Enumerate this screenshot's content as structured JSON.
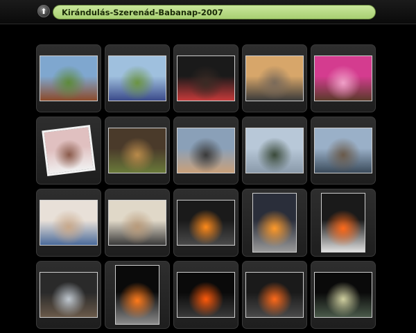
{
  "album": {
    "title": "Kirándulás-Szerenád-Babanap-2007",
    "up_icon": "up-arrow-icon"
  },
  "photos": [
    {
      "name": "photo-playground-slide",
      "shape": "land",
      "colors": [
        "#7fa7cf",
        "#5d8a3a",
        "#8c4a2a"
      ]
    },
    {
      "name": "photo-kids-on-lawn",
      "shape": "land",
      "colors": [
        "#9fc0de",
        "#6b9442",
        "#3a4a8a"
      ]
    },
    {
      "name": "photo-night-friends",
      "shape": "land",
      "colors": [
        "#1a1a1a",
        "#3a2a24",
        "#c63a3a"
      ]
    },
    {
      "name": "photo-girls-on-sofa",
      "shape": "land",
      "colors": [
        "#d7a66a",
        "#7a6a5a",
        "#3a3a3a"
      ]
    },
    {
      "name": "photo-heart-frame",
      "shape": "land",
      "colors": [
        "#d43c8f",
        "#f0a0c8",
        "#5a3a2a"
      ]
    },
    {
      "name": "photo-tilted-portrait",
      "shape": "rot",
      "colors": [
        "#e0c0c0",
        "#8a5a4a",
        "#f0f0f0"
      ]
    },
    {
      "name": "photo-blonde-girl",
      "shape": "land",
      "colors": [
        "#4a3a2a",
        "#b98a4a",
        "#6a7a3a"
      ]
    },
    {
      "name": "photo-two-girls-closeup",
      "shape": "land",
      "colors": [
        "#8aa0b8",
        "#3a3a3a",
        "#c9a07a"
      ]
    },
    {
      "name": "photo-group-street",
      "shape": "land",
      "colors": [
        "#b8c8d8",
        "#3a4a3a",
        "#8a9aaa"
      ]
    },
    {
      "name": "photo-church-group",
      "shape": "land",
      "colors": [
        "#9ab0c8",
        "#6a5a4a",
        "#3a4a5a"
      ]
    },
    {
      "name": "photo-indoor-table",
      "shape": "land",
      "colors": [
        "#e8e0d8",
        "#c8a88a",
        "#4a6a9a"
      ]
    },
    {
      "name": "photo-boys-sitting",
      "shape": "land",
      "colors": [
        "#e0d8c8",
        "#b89a7a",
        "#3a3a3a"
      ]
    },
    {
      "name": "photo-bonfire-1",
      "shape": "land",
      "colors": [
        "#1a1a1a",
        "#ff8a1a",
        "#4a4a4a"
      ]
    },
    {
      "name": "photo-bonfire-2",
      "shape": "port",
      "colors": [
        "#2a2e3a",
        "#ff9a2a",
        "#9a9a9a"
      ]
    },
    {
      "name": "photo-bonfire-3",
      "shape": "port",
      "colors": [
        "#1a1a1a",
        "#ff6a1a",
        "#e0e0e0"
      ]
    },
    {
      "name": "photo-night-group",
      "shape": "land",
      "colors": [
        "#2a2a2a",
        "#c0c8d0",
        "#6a5a4a"
      ]
    },
    {
      "name": "photo-dark-fire",
      "shape": "port",
      "colors": [
        "#0a0a0a",
        "#ff7a1a",
        "#8a8a8a"
      ]
    },
    {
      "name": "photo-embers-1",
      "shape": "land",
      "colors": [
        "#0a0a0a",
        "#ff5a0a",
        "#3a3a3a"
      ]
    },
    {
      "name": "photo-embers-2",
      "shape": "land",
      "colors": [
        "#1a1a1a",
        "#ff6a1a",
        "#4a4a4a"
      ]
    },
    {
      "name": "photo-night-kids",
      "shape": "land",
      "colors": [
        "#0a0a0a",
        "#d0d0a0",
        "#4a5a4a"
      ]
    }
  ]
}
